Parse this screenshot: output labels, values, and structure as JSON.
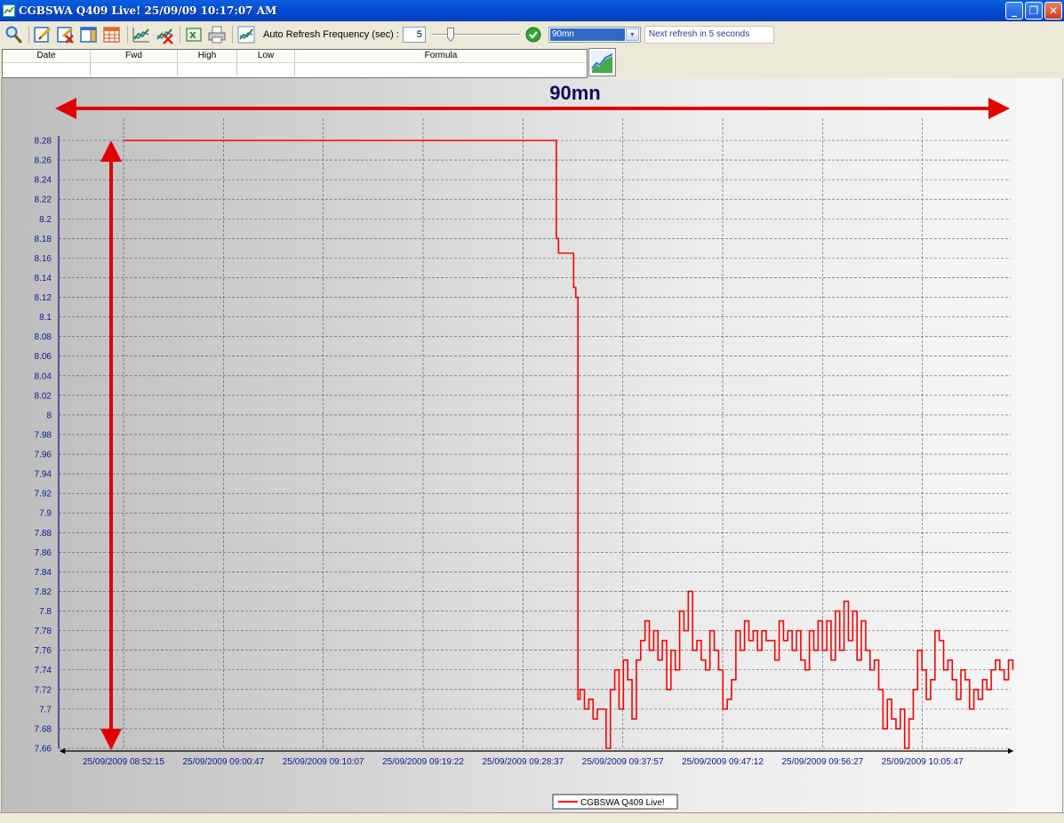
{
  "window": {
    "title": "CGBSWA Q409 Live! 25/09/09 10:17:07 AM",
    "minimize": "_",
    "restore": "❐",
    "close": "✕"
  },
  "toolbar": {
    "refresh_label": "Auto Refresh Frequency (sec) :",
    "refresh_value": "5",
    "timeframe_value": "90mn",
    "status": "Next refresh in 5 seconds",
    "icons": [
      "search-icon",
      "edit-icon",
      "delete-icon",
      "panel-icon",
      "table-icon",
      "chart-add-icon",
      "chart-remove-icon",
      "excel-icon",
      "print-icon",
      "chart-icon",
      "ok-icon",
      "chevron-down-icon"
    ]
  },
  "grid": {
    "columns": [
      "Date",
      "Fwd",
      "High",
      "Low",
      "Formula"
    ]
  },
  "annotation": {
    "label": "90mn",
    "color": "#e00000"
  },
  "colors": {
    "series": "#ff0000",
    "axis_labels": "#0a1a8c",
    "titlebar": "#0550d6"
  },
  "chart_data": {
    "type": "line",
    "title": "",
    "xlabel": "",
    "ylabel": "",
    "ylim": [
      7.66,
      8.28
    ],
    "yticks": [
      "8.28",
      "8.26",
      "8.24",
      "8.22",
      "8.2",
      "8.18",
      "8.16",
      "8.14",
      "8.12",
      "8.1",
      "8.08",
      "8.06",
      "8.04",
      "8.02",
      "8",
      "7.98",
      "7.96",
      "7.94",
      "7.92",
      "7.9",
      "7.88",
      "7.86",
      "7.84",
      "7.82",
      "7.8",
      "7.78",
      "7.76",
      "7.74",
      "7.72",
      "7.7",
      "7.68",
      "7.66"
    ],
    "xticks": [
      "25/09/2009 08:52:15",
      "25/09/2009 09:00:47",
      "25/09/2009 09:10:07",
      "25/09/2009 09:19:22",
      "25/09/2009 09:28:37",
      "25/09/2009 09:37:57",
      "25/09/2009 09:47:12",
      "25/09/2009 09:56:27",
      "25/09/2009 10:05:47"
    ],
    "xlim_minutes_from_first_tick": [
      -6,
      82
    ],
    "grid": true,
    "legend": "bottom-center",
    "series": [
      {
        "name": "CGBSWA Q409 Live!",
        "x_minutes_from_first_tick": [
          0,
          39.8,
          40.0,
          40.2,
          40.4,
          40.6,
          41.0,
          41.6,
          41.8,
          42.0,
          42.2,
          42.6,
          43.0,
          43.4,
          43.8,
          44.2,
          44.6,
          45.0,
          45.4,
          45.8,
          46.2,
          46.6,
          47.0,
          47.4,
          47.8,
          48.2,
          48.6,
          49.0,
          49.4,
          49.8,
          50.2,
          50.6,
          51.0,
          51.4,
          51.8,
          52.2,
          52.6,
          53.0,
          53.4,
          53.8,
          54.2,
          54.6,
          55.0,
          55.4,
          55.8,
          56.2,
          56.6,
          57.0,
          57.4,
          57.8,
          58.2,
          58.6,
          59.0,
          59.4,
          59.8,
          60.2,
          60.6,
          61.0,
          61.4,
          61.8,
          62.2,
          62.6,
          63.0,
          63.4,
          63.8,
          64.2,
          64.6,
          65.0,
          65.4,
          65.8,
          66.2,
          66.6,
          67.0,
          67.4,
          67.8,
          68.2,
          68.6,
          69.0,
          69.4,
          69.8,
          70.2,
          70.6,
          71.0,
          71.4,
          71.8,
          72.2,
          72.6,
          73.0,
          73.4,
          73.8,
          74.2,
          74.6,
          75.0,
          75.4,
          75.8,
          76.2,
          76.6,
          77.0,
          77.4,
          77.8,
          78.2,
          78.6,
          79.0,
          79.4,
          79.8,
          80.2,
          80.6,
          81.0,
          81.4,
          81.8,
          82.2
        ],
        "y": [
          8.28,
          8.28,
          8.18,
          8.165,
          8.165,
          8.165,
          8.165,
          8.13,
          8.12,
          7.71,
          7.72,
          7.7,
          7.71,
          7.69,
          7.7,
          7.7,
          7.66,
          7.72,
          7.74,
          7.7,
          7.75,
          7.73,
          7.69,
          7.75,
          7.77,
          7.79,
          7.76,
          7.78,
          7.75,
          7.77,
          7.72,
          7.76,
          7.74,
          7.8,
          7.78,
          7.82,
          7.76,
          7.77,
          7.75,
          7.74,
          7.78,
          7.76,
          7.74,
          7.7,
          7.71,
          7.73,
          7.78,
          7.76,
          7.79,
          7.77,
          7.78,
          7.76,
          7.78,
          7.77,
          7.77,
          7.75,
          7.79,
          7.77,
          7.78,
          7.76,
          7.78,
          7.75,
          7.74,
          7.78,
          7.76,
          7.79,
          7.76,
          7.79,
          7.75,
          7.8,
          7.76,
          7.81,
          7.77,
          7.8,
          7.75,
          7.79,
          7.76,
          7.74,
          7.75,
          7.72,
          7.68,
          7.71,
          7.69,
          7.68,
          7.7,
          7.66,
          7.69,
          7.72,
          7.76,
          7.74,
          7.71,
          7.73,
          7.78,
          7.77,
          7.74,
          7.75,
          7.73,
          7.71,
          7.74,
          7.73,
          7.7,
          7.72,
          7.71,
          7.73,
          7.72,
          7.74,
          7.75,
          7.74,
          7.73,
          7.75,
          7.74
        ]
      }
    ]
  }
}
